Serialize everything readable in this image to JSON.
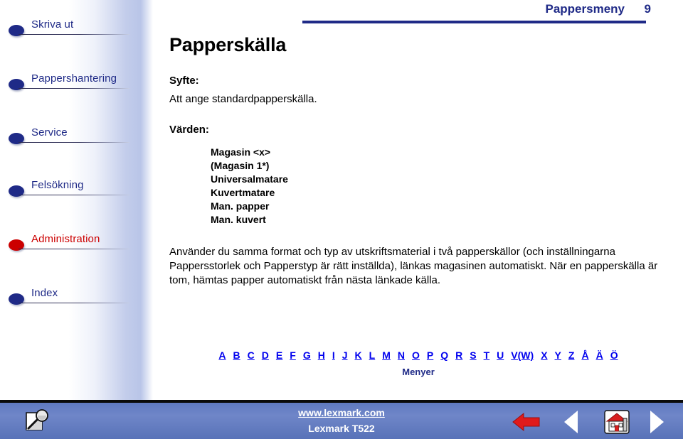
{
  "header": {
    "title": "Pappersmeny",
    "page_number": "9",
    "accent_color": "#1f2a87"
  },
  "sidebar": {
    "items": [
      {
        "label": "Skriva ut",
        "state": "normal",
        "icon": "bullet-icon"
      },
      {
        "label": "Pappershantering",
        "state": "normal",
        "icon": "bullet-icon"
      },
      {
        "label": "Service",
        "state": "normal",
        "icon": "bullet-icon"
      },
      {
        "label": "Felsökning",
        "state": "normal",
        "icon": "bullet-icon"
      },
      {
        "label": "Administration",
        "state": "current",
        "icon": "bullet-icon"
      },
      {
        "label": "Index",
        "state": "normal",
        "icon": "bullet-icon"
      }
    ],
    "current_color": "#cc0000",
    "link_color": "#1f2a87"
  },
  "main": {
    "title": "Papperskälla",
    "purpose_heading": "Syfte:",
    "purpose_text": "Att ange standardpapperskälla.",
    "values_heading": "Värden:",
    "values": [
      "Magasin <x>",
      "(Magasin 1*)",
      "Universalmatare",
      "Kuvertmatare",
      "Man. papper",
      "Man. kuvert"
    ],
    "description": "Använder du samma format och typ av utskriftsmaterial i två papperskällor (och inställningarna Pappersstorlek och Papperstyp är rätt inställda), länkas magasinen automatiskt. När en papperskälla är tom, hämtas papper automatiskt från nästa länkade källa."
  },
  "alpha_index": {
    "letters": [
      "A",
      "B",
      "C",
      "D",
      "E",
      "F",
      "G",
      "H",
      "I",
      "J",
      "K",
      "L",
      "M",
      "N",
      "O",
      "P",
      "Q",
      "R",
      "S",
      "T",
      "U",
      "V(W)",
      "X",
      "Y",
      "Z",
      "Å",
      "Ä",
      "Ö"
    ],
    "caption": "Menyer"
  },
  "footer": {
    "url": "www.lexmark.com",
    "model": "Lexmark T522",
    "search_icon": "page-magnifier-icon",
    "nav": [
      {
        "name": "back-arrow-icon",
        "label": "Tillbaka"
      },
      {
        "name": "prev-arrow-icon",
        "label": "Föregående"
      },
      {
        "name": "home-icon",
        "label": "Hem"
      },
      {
        "name": "next-arrow-icon",
        "label": "Nästa"
      }
    ]
  }
}
